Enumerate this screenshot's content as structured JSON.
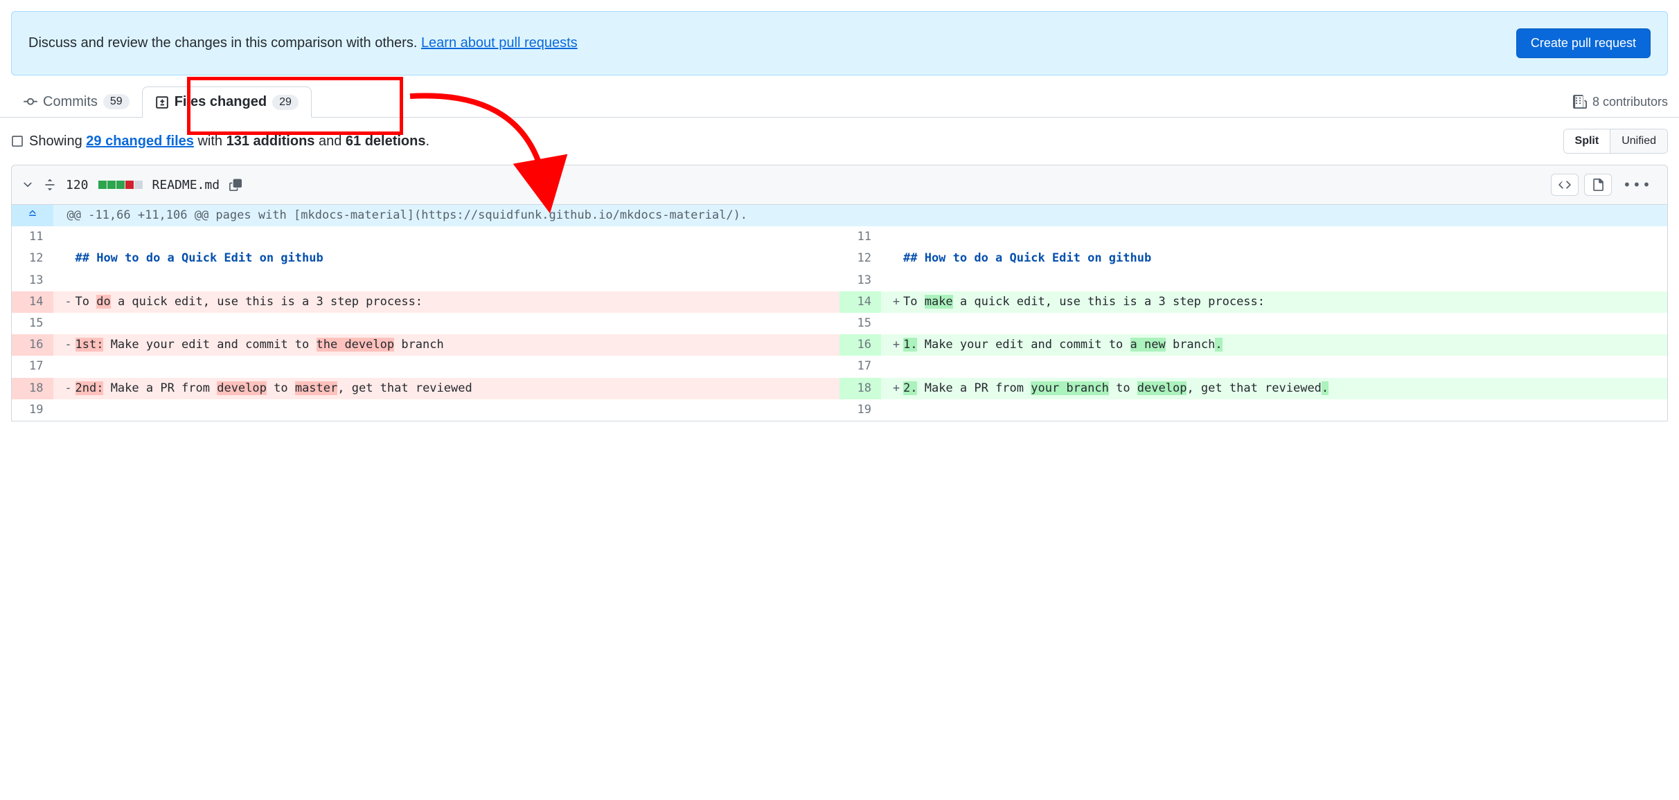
{
  "alert": {
    "text_before": "Discuss and review the changes in this comparison with others. ",
    "link": "Learn about pull requests",
    "button": "Create pull request"
  },
  "tabs": {
    "commits": {
      "label": "Commits",
      "count": "59"
    },
    "files": {
      "label": "Files changed",
      "count": "29"
    }
  },
  "contributors": "8 contributors",
  "summary": {
    "showing": "Showing ",
    "files_link": "29 changed files",
    "middle1": " with ",
    "additions": "131 additions",
    "middle2": " and ",
    "deletions": "61 deletions",
    "end": "."
  },
  "view": {
    "split": "Split",
    "unified": "Unified"
  },
  "file": {
    "line_count": "120",
    "name": "README.md"
  },
  "hunk": {
    "text": "@@ -11,66 +11,106 @@ pages with [mkdocs-material](https://squidfunk.github.io/mkdocs-material/)."
  },
  "rows": [
    {
      "ln_old": "11",
      "ln_new": "11",
      "old_type": "ctx",
      "new_type": "ctx",
      "old_code": "",
      "new_code": ""
    },
    {
      "ln_old": "12",
      "ln_new": "12",
      "old_type": "ctx",
      "new_type": "ctx",
      "old_md": "## How to do a Quick Edit on github",
      "new_md": "## How to do a Quick Edit on github"
    },
    {
      "ln_old": "13",
      "ln_new": "13",
      "old_type": "ctx",
      "new_type": "ctx",
      "old_code": "",
      "new_code": ""
    },
    {
      "ln_old": "14",
      "ln_new": "14",
      "old_type": "del",
      "new_type": "add",
      "old_parts": [
        "To ",
        {
          "h": "do"
        },
        " a quick edit, use this is a 3 step process:"
      ],
      "new_parts": [
        "To ",
        {
          "h": "make"
        },
        " a quick edit, use this is a 3 step process:"
      ]
    },
    {
      "ln_old": "15",
      "ln_new": "15",
      "old_type": "ctx",
      "new_type": "ctx",
      "old_code": "",
      "new_code": ""
    },
    {
      "ln_old": "16",
      "ln_new": "16",
      "old_type": "del",
      "new_type": "add",
      "old_parts": [
        {
          "h": "1st:"
        },
        " Make your edit and commit to ",
        {
          "h": "the develop"
        },
        " branch"
      ],
      "new_parts": [
        {
          "h": "1."
        },
        " Make your edit and commit to ",
        {
          "h": "a new"
        },
        " branch",
        {
          "h": "."
        }
      ]
    },
    {
      "ln_old": "17",
      "ln_new": "17",
      "old_type": "ctx",
      "new_type": "ctx",
      "old_code": "",
      "new_code": ""
    },
    {
      "ln_old": "18",
      "ln_new": "18",
      "old_type": "del",
      "new_type": "add",
      "old_parts": [
        {
          "h": "2nd:"
        },
        " Make a PR from ",
        {
          "h": "develop"
        },
        " to ",
        {
          "h": "master"
        },
        ", get that reviewed"
      ],
      "new_parts": [
        {
          "h": "2."
        },
        " Make a PR from ",
        {
          "h": "your branch"
        },
        " to ",
        {
          "h": "develop"
        },
        ", get that reviewed",
        {
          "h": "."
        }
      ]
    },
    {
      "ln_old": "19",
      "ln_new": "19",
      "old_type": "ctx",
      "new_type": "ctx",
      "old_code": "",
      "new_code": ""
    }
  ]
}
